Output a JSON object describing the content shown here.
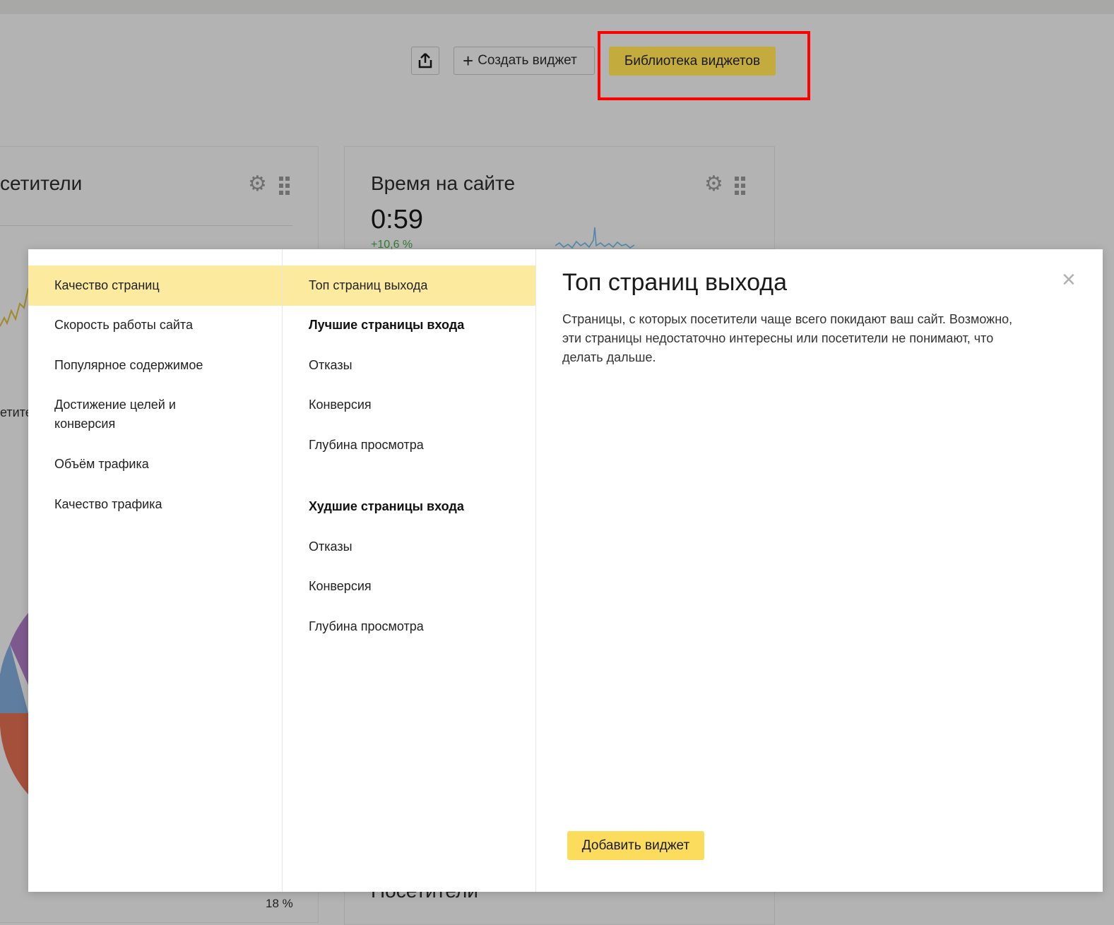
{
  "toolbar": {
    "share_icon": "share-upload-icon",
    "create_plus": "+",
    "create_label": "Создать виджет",
    "library_label": "Библиотека виджетов",
    "highlight_color": "#ff0000"
  },
  "background": {
    "left_widget_title": "сетители",
    "left_fragment_text": "етите",
    "right_widget_title": "Время на сайте",
    "right_widget_value": "0:59",
    "right_widget_delta": "+10,6 %",
    "bottom_widget_title": "Посетители",
    "pie_percent_label": "18 %",
    "gear_icon": "gear-icon",
    "grip_icon": "drag-handle-icon"
  },
  "modal": {
    "categories": [
      {
        "label": "Качество страниц",
        "selected": true
      },
      {
        "label": "Скорость работы сайта"
      },
      {
        "label": "Популярное содержимое"
      },
      {
        "label": "Достижение целей и конверсия"
      },
      {
        "label": "Объём трафика"
      },
      {
        "label": "Качество трафика"
      }
    ],
    "widgets": [
      {
        "label": "Топ страниц выхода",
        "selected": true
      },
      {
        "label": "Лучшие страницы входа",
        "group": true
      },
      {
        "label": "Отказы"
      },
      {
        "label": "Конверсия"
      },
      {
        "label": "Глубина просмотра"
      },
      {
        "label": "Худшие страницы входа",
        "group": true
      },
      {
        "label": "Отказы"
      },
      {
        "label": "Конверсия"
      },
      {
        "label": "Глубина просмотра"
      }
    ],
    "detail": {
      "title": "Топ страниц выхода",
      "description": "Страницы, с которых посетители чаще всего покидают ваш сайт. Возможно, эти страницы недостаточно интересны или посетители не понимают, что делать дальше.",
      "add_button": "Добавить виджет",
      "close_icon": "close-icon",
      "close_glyph": "×"
    },
    "accent_color": "#fcdc5c",
    "selected_bg": "#fceb9f"
  }
}
